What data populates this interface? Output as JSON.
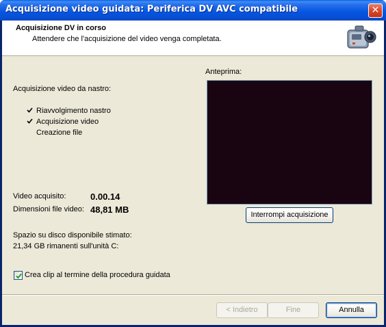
{
  "window": {
    "title": "Acquisizione video guidata: Periferica DV AVC compatibile",
    "close_label": "✕"
  },
  "header": {
    "title": "Acquisizione DV in corso",
    "subtitle": "Attendere che l'acquisizione del video venga completata.",
    "icon": "camcorder-icon"
  },
  "progress": {
    "heading": "Acquisizione video da nastro:",
    "steps": [
      {
        "label": "Riavvolgimento nastro",
        "done": true
      },
      {
        "label": "Acquisizione video",
        "done": true
      },
      {
        "label": "Creazione file",
        "done": false
      }
    ]
  },
  "stats": {
    "captured_label": "Video acquisito:",
    "captured_value": "0.00.14",
    "filesize_label": "Dimensioni file video:",
    "filesize_value": "48,81 MB",
    "disk_label": "Spazio su disco disponibile stimato:",
    "disk_value": "21,34 GB rimanenti sull'unità C:"
  },
  "preview": {
    "label": "Anteprima:",
    "stop_button": "Interrompi acquisizione",
    "background_color": "#190511"
  },
  "options": {
    "create_clips_label": "Crea clip al termine della procedura guidata",
    "create_clips_checked": true
  },
  "footer": {
    "back_button": "< Indietro",
    "finish_button": "Fine",
    "cancel_button": "Annulla"
  },
  "colors": {
    "titlebar": "#0757e0",
    "dialog_bg": "#ece9d8",
    "check_green": "#21a121"
  }
}
